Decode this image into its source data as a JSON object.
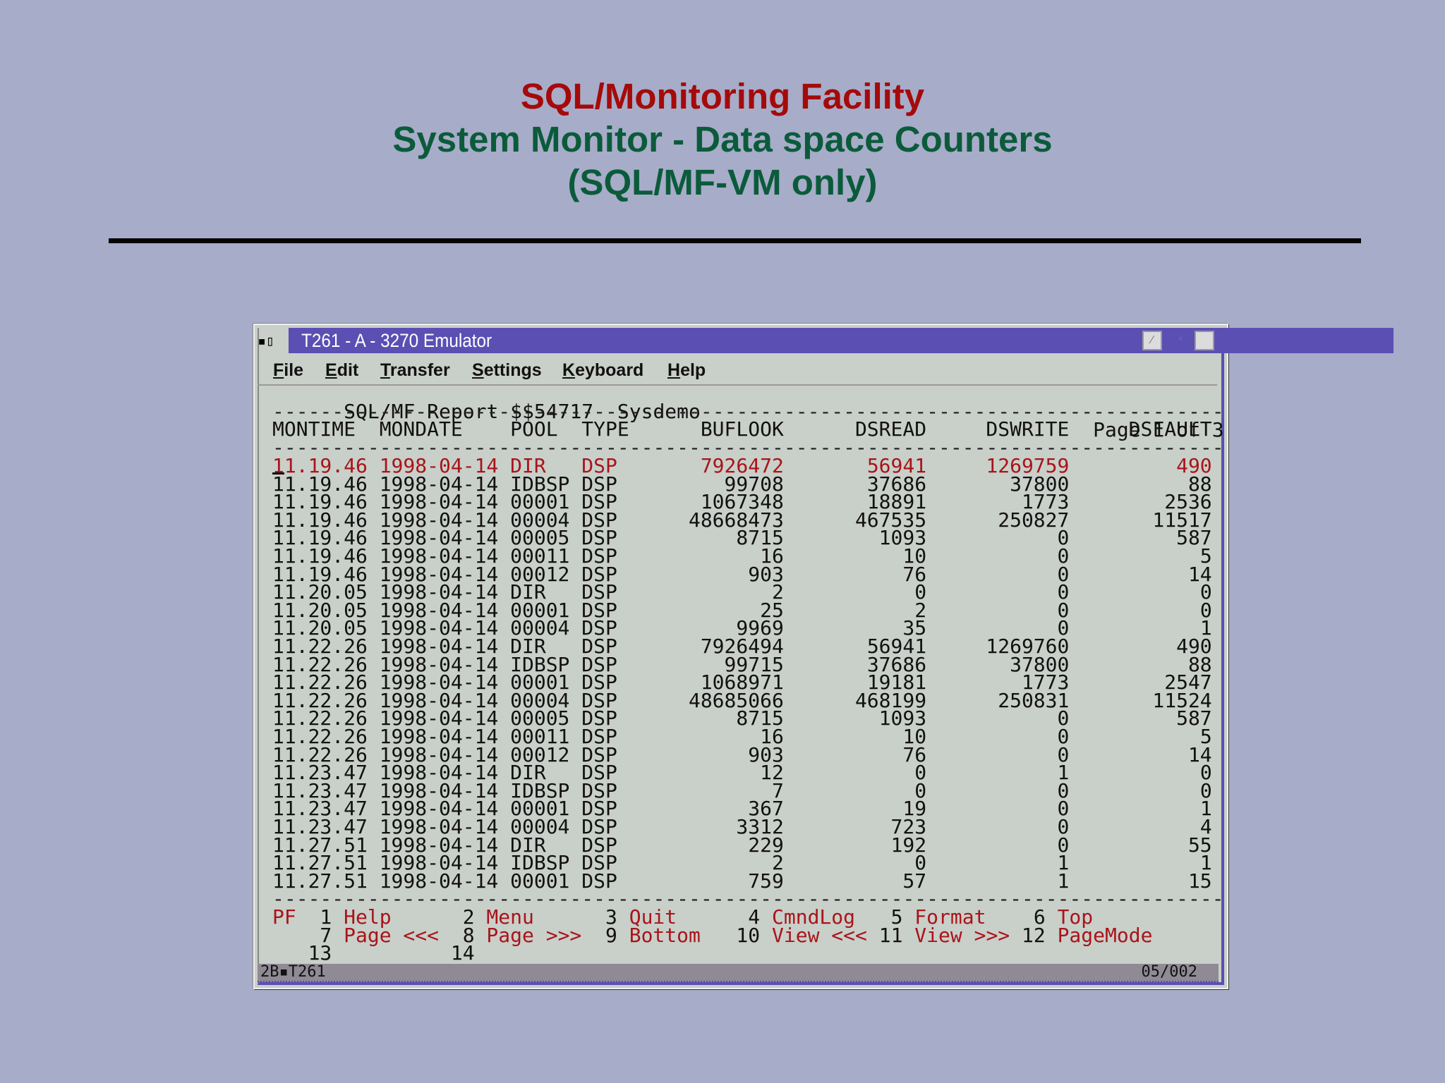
{
  "slide": {
    "title_line1": "SQL/Monitoring Facility",
    "title_line2": "System Monitor -  Data space Counters",
    "title_line3": "(SQL/MF-VM only)"
  },
  "window": {
    "title": "T261 - A - 3270 Emulator",
    "menu": [
      "File",
      "Edit",
      "Transfer",
      "Settings",
      "Keyboard",
      "Help"
    ]
  },
  "report": {
    "heading_left": "SQL/MF Report $$54717  Sysdemo",
    "heading_right": "Page 1 of 3",
    "columns": [
      "MONTIME",
      "MONDATE",
      "POOL",
      "TYPE",
      "BUFLOOK",
      "DSREAD",
      "DSWRITE",
      "DSFAULT"
    ],
    "rows": [
      [
        "11.19.46",
        "1998-04-14",
        "DIR",
        "DSP",
        "7926472",
        "56941",
        "1269759",
        "490"
      ],
      [
        "11.19.46",
        "1998-04-14",
        "IDBSP",
        "DSP",
        "99708",
        "37686",
        "37800",
        "88"
      ],
      [
        "11.19.46",
        "1998-04-14",
        "00001",
        "DSP",
        "1067348",
        "18891",
        "1773",
        "2536"
      ],
      [
        "11.19.46",
        "1998-04-14",
        "00004",
        "DSP",
        "48668473",
        "467535",
        "250827",
        "11517"
      ],
      [
        "11.19.46",
        "1998-04-14",
        "00005",
        "DSP",
        "8715",
        "1093",
        "0",
        "587"
      ],
      [
        "11.19.46",
        "1998-04-14",
        "00011",
        "DSP",
        "16",
        "10",
        "0",
        "5"
      ],
      [
        "11.19.46",
        "1998-04-14",
        "00012",
        "DSP",
        "903",
        "76",
        "0",
        "14"
      ],
      [
        "11.20.05",
        "1998-04-14",
        "DIR",
        "DSP",
        "2",
        "0",
        "0",
        "0"
      ],
      [
        "11.20.05",
        "1998-04-14",
        "00001",
        "DSP",
        "25",
        "2",
        "0",
        "0"
      ],
      [
        "11.20.05",
        "1998-04-14",
        "00004",
        "DSP",
        "9969",
        "35",
        "0",
        "1"
      ],
      [
        "11.22.26",
        "1998-04-14",
        "DIR",
        "DSP",
        "7926494",
        "56941",
        "1269760",
        "490"
      ],
      [
        "11.22.26",
        "1998-04-14",
        "IDBSP",
        "DSP",
        "99715",
        "37686",
        "37800",
        "88"
      ],
      [
        "11.22.26",
        "1998-04-14",
        "00001",
        "DSP",
        "1068971",
        "19181",
        "1773",
        "2547"
      ],
      [
        "11.22.26",
        "1998-04-14",
        "00004",
        "DSP",
        "48685066",
        "468199",
        "250831",
        "11524"
      ],
      [
        "11.22.26",
        "1998-04-14",
        "00005",
        "DSP",
        "8715",
        "1093",
        "0",
        "587"
      ],
      [
        "11.22.26",
        "1998-04-14",
        "00011",
        "DSP",
        "16",
        "10",
        "0",
        "5"
      ],
      [
        "11.22.26",
        "1998-04-14",
        "00012",
        "DSP",
        "903",
        "76",
        "0",
        "14"
      ],
      [
        "11.23.47",
        "1998-04-14",
        "DIR",
        "DSP",
        "12",
        "0",
        "1",
        "0"
      ],
      [
        "11.23.47",
        "1998-04-14",
        "IDBSP",
        "DSP",
        "7",
        "0",
        "0",
        "0"
      ],
      [
        "11.23.47",
        "1998-04-14",
        "00001",
        "DSP",
        "367",
        "19",
        "0",
        "1"
      ],
      [
        "11.23.47",
        "1998-04-14",
        "00004",
        "DSP",
        "3312",
        "723",
        "0",
        "4"
      ],
      [
        "11.27.51",
        "1998-04-14",
        "DIR",
        "DSP",
        "229",
        "192",
        "0",
        "55"
      ],
      [
        "11.27.51",
        "1998-04-14",
        "IDBSP",
        "DSP",
        "2",
        "0",
        "1",
        "1"
      ],
      [
        "11.27.51",
        "1998-04-14",
        "00001",
        "DSP",
        "759",
        "57",
        "1",
        "15"
      ]
    ]
  },
  "pf_keys": {
    "prefix": "PF",
    "lines": [
      [
        [
          "1",
          "Help"
        ],
        [
          "2",
          "Menu"
        ],
        [
          "3",
          "Quit"
        ],
        [
          "4",
          "CmndLog"
        ],
        [
          "5",
          "Format"
        ],
        [
          "6",
          "Top"
        ]
      ],
      [
        [
          "7",
          "Page <<<"
        ],
        [
          "8",
          "Page >>>"
        ],
        [
          "9",
          "Bottom"
        ],
        [
          "10",
          "View <<<"
        ],
        [
          "11",
          "View >>>"
        ],
        [
          "12",
          "PageMode"
        ]
      ],
      [
        [
          "13",
          ""
        ],
        [
          "14",
          ""
        ]
      ]
    ]
  },
  "status": {
    "left": "2B▪T261",
    "right": "05/002"
  },
  "colors": {
    "highlight": "#a8141a",
    "titlebar": "#5b4fb4",
    "title_red": "#a50a0a",
    "title_green": "#0b5b3b"
  }
}
